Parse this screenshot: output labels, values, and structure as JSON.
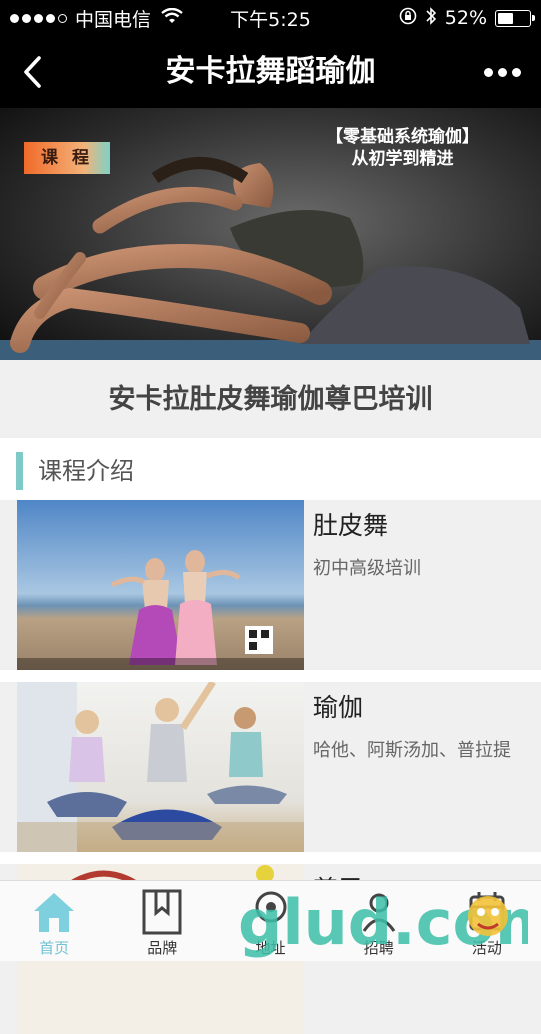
{
  "status": {
    "carrier": "中国电信",
    "time": "下午5:25",
    "battery": "52%",
    "battery_level": 0.52
  },
  "nav": {
    "title": "安卡拉舞蹈瑜伽"
  },
  "banner": {
    "tag": "课 程",
    "headline_line1": "【零基础系统瑜伽】",
    "headline_line2": "从初学到精进"
  },
  "course_title": "安卡拉肚皮舞瑜伽尊巴培训",
  "section_label": "课程介绍",
  "courses": [
    {
      "title": "肚皮舞",
      "desc": "初中高级培训"
    },
    {
      "title": "瑜伽",
      "desc": "哈他、阿斯汤加、普拉提"
    },
    {
      "title": "尊巴",
      "desc": ""
    }
  ],
  "tabs": [
    {
      "label": "首页",
      "icon": "home-icon"
    },
    {
      "label": "品牌",
      "icon": "bookmark-icon"
    },
    {
      "label": "地址",
      "icon": "location-icon"
    },
    {
      "label": "招聘",
      "icon": "recruit-icon"
    },
    {
      "label": "活动",
      "icon": "activity-icon"
    }
  ],
  "watermark": {
    "text": "glud.com"
  },
  "colors": {
    "accent": "#6fc3d3",
    "section_bar": "#7fc9c6",
    "nav_bg": "#000000"
  }
}
